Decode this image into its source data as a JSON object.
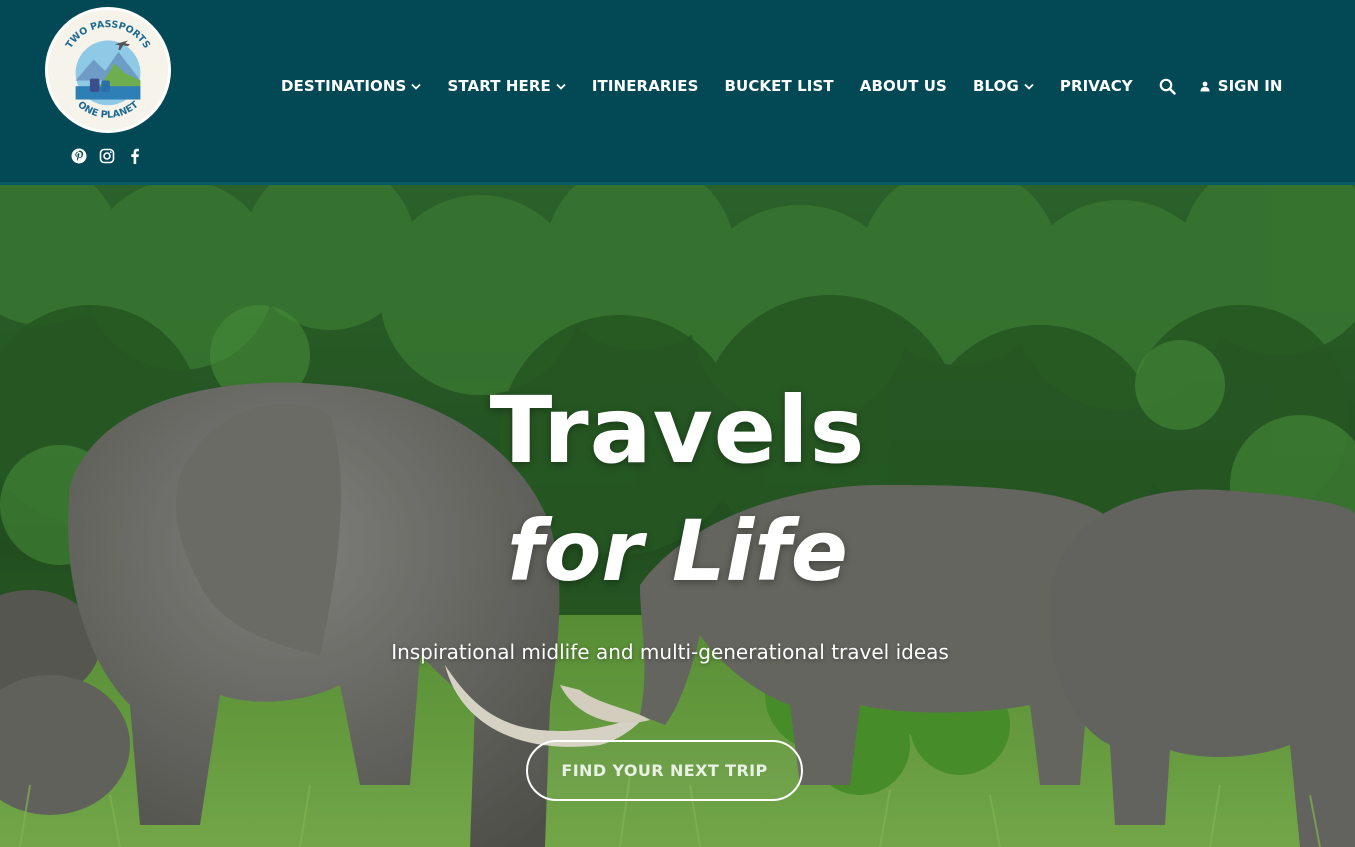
{
  "header": {
    "logo": {
      "top_text": "TWO PASSPORTS",
      "bottom_text": "ONE PLANET"
    },
    "social": [
      {
        "icon": "pinterest-icon"
      },
      {
        "icon": "instagram-icon"
      },
      {
        "icon": "facebook-icon"
      }
    ],
    "nav": {
      "items": [
        {
          "label": "DESTINATIONS",
          "has_dropdown": true
        },
        {
          "label": "START HERE",
          "has_dropdown": true
        },
        {
          "label": "ITINERARIES",
          "has_dropdown": false
        },
        {
          "label": "BUCKET LIST",
          "has_dropdown": false
        },
        {
          "label": "ABOUT US",
          "has_dropdown": false
        },
        {
          "label": "BLOG",
          "has_dropdown": true
        },
        {
          "label": "PRIVACY",
          "has_dropdown": false
        }
      ],
      "search_icon": "search-icon",
      "signin_label": "SIGN IN",
      "signin_icon": "user-icon"
    },
    "colors": {
      "background": "#024955",
      "text": "#ffffff"
    }
  },
  "hero": {
    "title_line1": "Travels",
    "title_line2": "for Life",
    "subtitle": "Inspirational midlife and multi-generational travel ideas",
    "cta_label": "FIND YOUR NEXT TRIP"
  }
}
